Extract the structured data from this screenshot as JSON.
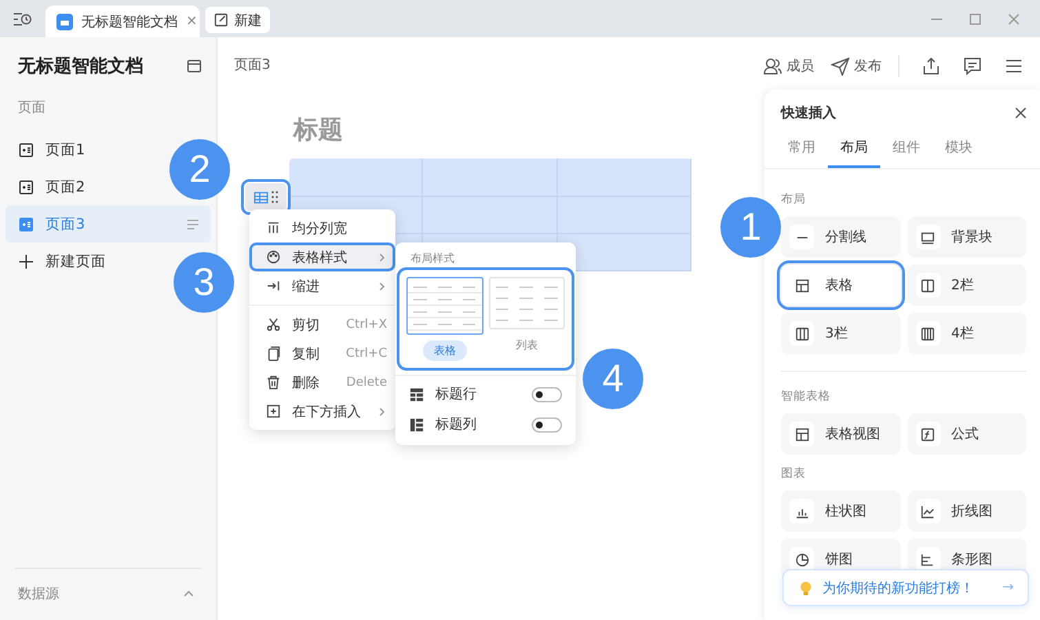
{
  "titlebar": {
    "tabs": [
      {
        "label": "无标题智能文档",
        "close": "×",
        "selected": true
      }
    ],
    "new_tab": "新建"
  },
  "sidebar": {
    "title": "无标题智能文档",
    "section": "页面",
    "items": [
      {
        "label": "页面1",
        "selected": false
      },
      {
        "label": "页面2",
        "selected": false
      },
      {
        "label": "页面3",
        "selected": true
      }
    ],
    "new_page": "新建页面",
    "footer": "数据源"
  },
  "header": {
    "breadcrumb": "页面3",
    "actions": [
      {
        "label": "成员"
      },
      {
        "label": "发布"
      }
    ]
  },
  "document": {
    "heading": "标题"
  },
  "table_menu": {
    "items": [
      {
        "kind": "item",
        "label": "均分列宽",
        "selected": false,
        "highlighted": false
      },
      {
        "kind": "item",
        "label": "表格样式",
        "submenu": true,
        "selected": true,
        "highlighted": true
      },
      {
        "kind": "item",
        "label": "缩进",
        "submenu": true,
        "selected": false,
        "highlighted": false
      },
      {
        "kind": "divider"
      },
      {
        "kind": "item",
        "label": "剪切",
        "shortcut": "Ctrl+X",
        "selected": false,
        "highlighted": false
      },
      {
        "kind": "item",
        "label": "复制",
        "shortcut": "Ctrl+C",
        "selected": false,
        "highlighted": false
      },
      {
        "kind": "item",
        "label": "删除",
        "shortcut": "Delete",
        "selected": false,
        "highlighted": false
      },
      {
        "kind": "item",
        "label": "在下方插入",
        "submenu": true,
        "selected": false,
        "highlighted": false
      }
    ]
  },
  "style_submenu": {
    "title": "布局样式",
    "highlighted": true,
    "styles": [
      {
        "label": "表格",
        "selected": true
      },
      {
        "label": "列表",
        "selected": false
      }
    ],
    "toggles": [
      {
        "label": "标题行",
        "on": false
      },
      {
        "label": "标题列",
        "on": false
      }
    ]
  },
  "quick_insert": {
    "title": "快速插入",
    "tabs": [
      {
        "label": "常用",
        "selected": false
      },
      {
        "label": "布局",
        "selected": true
      },
      {
        "label": "组件",
        "selected": false
      },
      {
        "label": "模块",
        "selected": false
      }
    ],
    "sections": [
      {
        "title": "布局",
        "items": [
          {
            "label": "分割线",
            "highlighted": false
          },
          {
            "label": "背景块",
            "highlighted": false
          },
          {
            "label": "表格",
            "highlighted": true
          },
          {
            "label": "2栏",
            "highlighted": false
          },
          {
            "label": "3栏",
            "highlighted": false
          },
          {
            "label": "4栏",
            "highlighted": false
          }
        ]
      },
      {
        "title": "智能表格",
        "items": [
          {
            "label": "表格视图",
            "highlighted": false
          },
          {
            "label": "公式",
            "highlighted": false
          }
        ]
      },
      {
        "title": "图表",
        "items": [
          {
            "label": "柱状图",
            "highlighted": false
          },
          {
            "label": "折线图",
            "highlighted": false
          },
          {
            "label": "饼图",
            "highlighted": false
          },
          {
            "label": "条形图",
            "highlighted": false
          }
        ]
      }
    ],
    "toast": {
      "text": "为你期待的新功能打榜！",
      "arrow": "→"
    }
  },
  "annotations": [
    {
      "number": "1"
    },
    {
      "number": "2"
    },
    {
      "number": "3"
    },
    {
      "number": "4"
    }
  ],
  "table_handle": {
    "highlighted": true
  }
}
